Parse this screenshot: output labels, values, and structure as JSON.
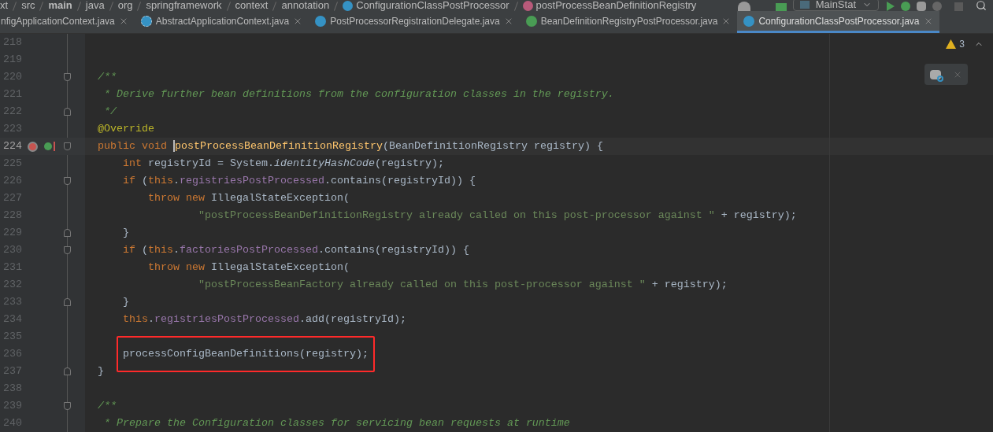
{
  "breadcrumbs": [
    {
      "label": "xt",
      "kind": "plain"
    },
    {
      "label": "src",
      "kind": "plain"
    },
    {
      "label": "main",
      "kind": "bold"
    },
    {
      "label": "java",
      "kind": "plain"
    },
    {
      "label": "org",
      "kind": "plain"
    },
    {
      "label": "springframework",
      "kind": "plain"
    },
    {
      "label": "context",
      "kind": "plain"
    },
    {
      "label": "annotation",
      "kind": "plain"
    },
    {
      "label": "ConfigurationClassPostProcessor",
      "kind": "class"
    },
    {
      "label": "postProcessBeanDefinitionRegistry",
      "kind": "method"
    }
  ],
  "run_config": "MainStat",
  "tabs": [
    {
      "label": "nfigApplicationContext.java",
      "kind": "none",
      "selected": false
    },
    {
      "label": "AbstractApplicationContext.java",
      "kind": "abstract",
      "selected": false
    },
    {
      "label": "PostProcessorRegistrationDelegate.java",
      "kind": "class",
      "selected": false
    },
    {
      "label": "BeanDefinitionRegistryPostProcessor.java",
      "kind": "interface",
      "selected": false
    },
    {
      "label": "ConfigurationClassPostProcessor.java",
      "kind": "class",
      "selected": true
    }
  ],
  "warnings": "3",
  "lines": [
    {
      "number": "218"
    },
    {
      "number": "219"
    },
    {
      "number": "220",
      "kind": "fold_start",
      "tokens": [
        {
          "text": "/**",
          "kind": "doc"
        }
      ]
    },
    {
      "number": "221",
      "tokens": [
        {
          "text": " * Derive further bean definitions from the configuration classes in the registry.",
          "kind": "doc"
        }
      ]
    },
    {
      "number": "222",
      "kind": "fold_end",
      "tokens": [
        {
          "text": " */",
          "kind": "doc"
        }
      ]
    },
    {
      "number": "223",
      "tokens": [
        {
          "text": "@Override",
          "kind": "annotation"
        }
      ]
    },
    {
      "number": "224",
      "kind": "fold_start",
      "current": true,
      "markers": true,
      "tokens": [
        {
          "text": "public void ",
          "kind": "keyword"
        },
        {
          "text": "postProcessBeanDefinitionRegistry",
          "kind": "method",
          "caret": true
        },
        {
          "text": "(BeanDefinitionRegistry registry) {",
          "kind": "plain"
        }
      ]
    },
    {
      "number": "225",
      "tokens": [
        {
          "text": "    int ",
          "kind": "keyword"
        },
        {
          "text": "registryId = System.",
          "kind": "plain"
        },
        {
          "text": "identityHashCode",
          "kind": "static"
        },
        {
          "text": "(registry);",
          "kind": "plain"
        }
      ]
    },
    {
      "number": "226",
      "kind": "fold_start",
      "tokens": [
        {
          "text": "    if ",
          "kind": "keyword"
        },
        {
          "text": "(",
          "kind": "plain"
        },
        {
          "text": "this",
          "kind": "keyword"
        },
        {
          "text": ".",
          "kind": "plain"
        },
        {
          "text": "registriesPostProcessed",
          "kind": "field"
        },
        {
          "text": ".contains(registryId)) {",
          "kind": "plain"
        }
      ]
    },
    {
      "number": "227",
      "tokens": [
        {
          "text": "        throw new ",
          "kind": "keyword"
        },
        {
          "text": "IllegalStateException(",
          "kind": "plain"
        }
      ]
    },
    {
      "number": "228",
      "tokens": [
        {
          "text": "                \"postProcessBeanDefinitionRegistry already called on this post-processor against \"",
          "kind": "string"
        },
        {
          "text": " + registry);",
          "kind": "plain"
        }
      ]
    },
    {
      "number": "229",
      "kind": "fold_end",
      "tokens": [
        {
          "text": "    }",
          "kind": "plain"
        }
      ]
    },
    {
      "number": "230",
      "kind": "fold_start",
      "tokens": [
        {
          "text": "    if ",
          "kind": "keyword"
        },
        {
          "text": "(",
          "kind": "plain"
        },
        {
          "text": "this",
          "kind": "keyword"
        },
        {
          "text": ".",
          "kind": "plain"
        },
        {
          "text": "factoriesPostProcessed",
          "kind": "field"
        },
        {
          "text": ".contains(registryId)) {",
          "kind": "plain"
        }
      ]
    },
    {
      "number": "231",
      "tokens": [
        {
          "text": "        throw new ",
          "kind": "keyword"
        },
        {
          "text": "IllegalStateException(",
          "kind": "plain"
        }
      ]
    },
    {
      "number": "232",
      "tokens": [
        {
          "text": "                \"postProcessBeanFactory already called on this post-processor against \"",
          "kind": "string"
        },
        {
          "text": " + registry);",
          "kind": "plain"
        }
      ]
    },
    {
      "number": "233",
      "kind": "fold_end",
      "tokens": [
        {
          "text": "    }",
          "kind": "plain"
        }
      ]
    },
    {
      "number": "234",
      "tokens": [
        {
          "text": "    this",
          "kind": "keyword"
        },
        {
          "text": ".",
          "kind": "plain"
        },
        {
          "text": "registriesPostProcessed",
          "kind": "field"
        },
        {
          "text": ".add(registryId);",
          "kind": "plain"
        }
      ]
    },
    {
      "number": "235"
    },
    {
      "number": "236",
      "boxed": true,
      "tokens": [
        {
          "text": "processConfigBeanDefinitions(registry);",
          "kind": "plain"
        }
      ]
    },
    {
      "number": "237",
      "kind": "fold_end",
      "tokens": [
        {
          "text": "}",
          "kind": "plain"
        }
      ]
    },
    {
      "number": "238"
    },
    {
      "number": "239",
      "kind": "fold_start",
      "tokens": [
        {
          "text": "/**",
          "kind": "doc"
        }
      ]
    },
    {
      "number": "240",
      "tokens": [
        {
          "text": " * Prepare the Configuration classes for servicing bean requests at runtime",
          "kind": "doc"
        }
      ]
    }
  ]
}
